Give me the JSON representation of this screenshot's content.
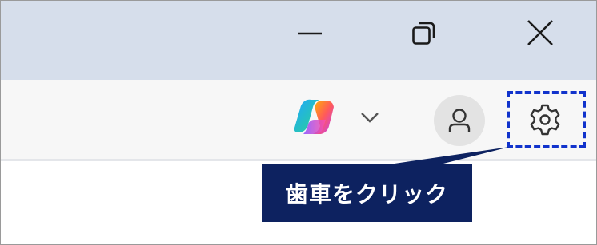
{
  "window_controls": {
    "minimize_icon": "minimize-icon",
    "maximize_icon": "restore-icon",
    "close_icon": "close-icon"
  },
  "toolbar": {
    "copilot_icon": "copilot-icon",
    "dropdown_icon": "chevron-down-icon",
    "profile_icon": "person-icon",
    "settings_icon": "gear-icon"
  },
  "annotation": {
    "callout_text": "歯車をクリック",
    "highlight_color": "#1133cc",
    "callout_bg": "#0d2260"
  },
  "colors": {
    "titlebar": "#d6deeb",
    "toolbar": "#f7f7f7",
    "avatar_bg": "#e3e3e3"
  }
}
